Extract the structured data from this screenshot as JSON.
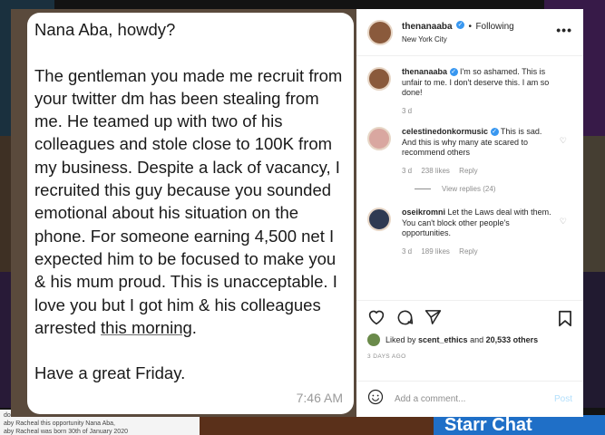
{
  "background": {
    "caption_text": "dor\naby Racheal this opportunity  Nana Aba,\naby Racheal was born 30th of January 2020",
    "banner_text": "Starr Chat"
  },
  "post_image": {
    "message_lines": [
      "Nana Aba, howdy?",
      "",
      "The gentleman you made me recruit from your twitter dm has been stealing from me. He teamed up with two of his colleagues and stole close to 100K from my business. Despite a lack of vacancy, I recruited this guy because you sounded emotional about his situation on the phone. For someone earning 4,500 net I expected him to be focused to make you & his mum proud. This is unacceptable. I love you but I got him & his colleagues arrested "
    ],
    "message_link": "this morning",
    "message_after_link": ".",
    "closing": "Have a great Friday.",
    "time": "7:46 AM"
  },
  "header": {
    "username": "thenanaaba",
    "separator": "•",
    "follow_state": "Following",
    "location": "New York City",
    "more_icon": "•••"
  },
  "comments": [
    {
      "username": "thenanaaba",
      "text": "I'm so ashamed. This is unfair to me. I don't deserve this. I am so done!",
      "time": "3 d",
      "likes": "",
      "reply": ""
    },
    {
      "username": "celestinedonkormusic",
      "text": "This is sad. And this is why many ate scared to recommend others",
      "time": "3 d",
      "likes": "238 likes",
      "reply": "Reply",
      "view_replies": "View replies (24)"
    },
    {
      "username": "oseikromni",
      "text": "Let the Laws deal with them. You can't block other people's opportunities.",
      "time": "3 d",
      "likes": "189 likes",
      "reply": "Reply"
    }
  ],
  "likes": {
    "prefix": "Liked by ",
    "user": "scent_ethics",
    "middle": " and ",
    "count": "20,533 others"
  },
  "posted_ago": "3 DAYS AGO",
  "add_comment": {
    "placeholder": "Add a comment...",
    "post_label": "Post"
  },
  "colors": {
    "accent": "#3897f0",
    "post_disabled": "#b2dffc"
  }
}
